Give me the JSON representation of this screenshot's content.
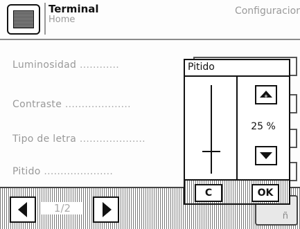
{
  "header": {
    "title": "Terminal",
    "subtitle": "Home",
    "section": "Configuracior"
  },
  "rows": [
    {
      "label": "Luminosidad",
      "dots": "............"
    },
    {
      "label": "Contraste",
      "dots": "...................."
    },
    {
      "label": "Tipo de letra",
      "dots": "...................."
    },
    {
      "label": "Pitido",
      "dots": "....................."
    }
  ],
  "footer": {
    "page_indicator": "1/2",
    "right_button_label": "ñ"
  },
  "popup": {
    "title": "Pitido",
    "value_text": "25 %",
    "value_fraction": 0.25,
    "cancel_label": "C",
    "ok_label": "OK"
  }
}
